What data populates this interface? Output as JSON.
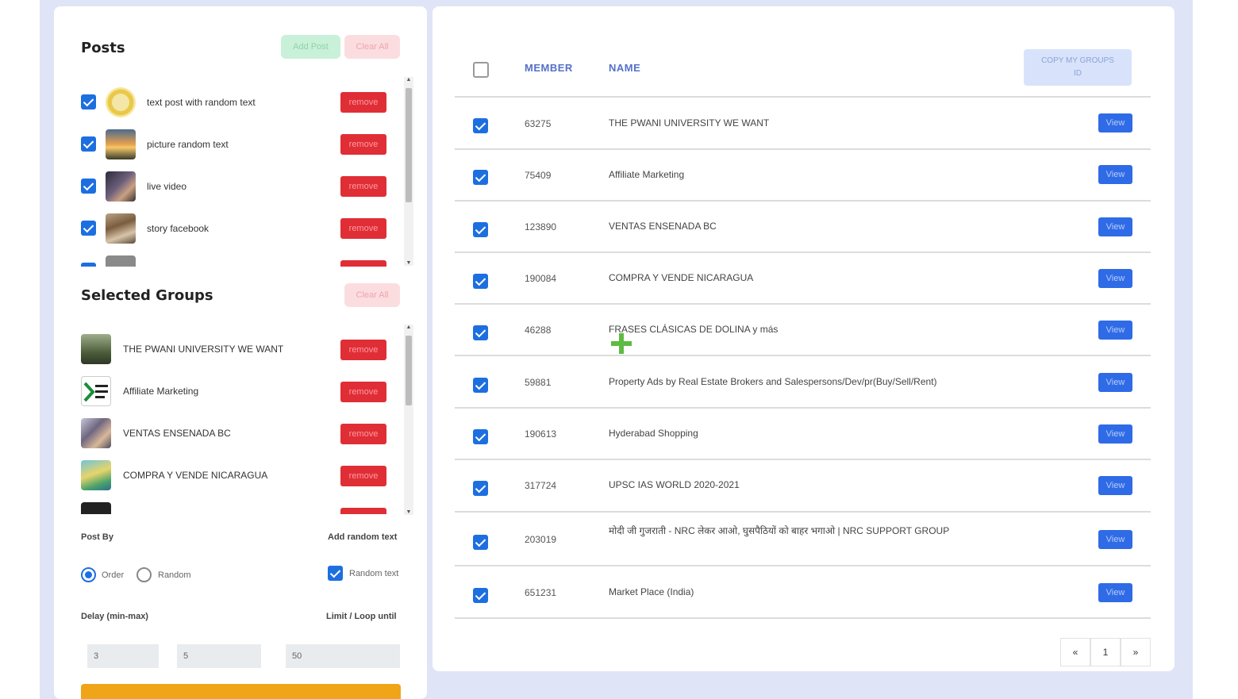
{
  "posts": {
    "title": "Posts",
    "add_post_label": "Add Post",
    "clear_all_label": "Clear All",
    "items": [
      {
        "label": "text post with random text",
        "checked": true,
        "remove_label": "remove"
      },
      {
        "label": "picture random text",
        "checked": true,
        "remove_label": "remove"
      },
      {
        "label": "live video",
        "checked": true,
        "remove_label": "remove"
      },
      {
        "label": "story facebook",
        "checked": true,
        "remove_label": "remove"
      }
    ]
  },
  "selected_groups": {
    "title": "Selected Groups",
    "clear_all_label": "Clear All",
    "items": [
      {
        "label": "THE PWANI UNIVERSITY WE WANT",
        "remove_label": "remove"
      },
      {
        "label": "Affiliate Marketing",
        "remove_label": "remove"
      },
      {
        "label": "VENTAS ENSENADA BC",
        "remove_label": "remove"
      },
      {
        "label": "COMPRA Y VENDE NICARAGUA",
        "remove_label": "remove"
      }
    ]
  },
  "settings": {
    "post_by_label": "Post By",
    "add_random_text_label": "Add random text",
    "option_order": "Order",
    "option_random": "Random",
    "selected_option": "Order",
    "random_text_label": "Random text",
    "random_text_checked": true,
    "delay_label": "Delay (min-max)",
    "limit_label": "Limit / Loop until",
    "delay_min": "3",
    "delay_max": "5",
    "limit_value": "50"
  },
  "table": {
    "col_member": "MEMBER",
    "col_name": "NAME",
    "copy_button_label": "COPY MY GROUPS ID",
    "view_label": "View",
    "rows": [
      {
        "member": "63275",
        "name": "THE PWANI UNIVERSITY WE WANT"
      },
      {
        "member": "75409",
        "name": "Affiliate Marketing"
      },
      {
        "member": "123890",
        "name": "VENTAS ENSENADA BC"
      },
      {
        "member": "190084",
        "name": "COMPRA Y VENDE NICARAGUA"
      },
      {
        "member": "46288",
        "name": "FRASES CLÁSICAS DE DOLINA y más"
      },
      {
        "member": "59881",
        "name": "Property Ads by Real Estate Brokers and Salespersons/Dev/pr(Buy/Sell/Rent)"
      },
      {
        "member": "190613",
        "name": "Hyderabad Shopping"
      },
      {
        "member": "317724",
        "name": "UPSC IAS WORLD 2020-2021"
      },
      {
        "member": "203019",
        "name": "मोदी जी गुजराती - NRC लेकर आओ, घुसपैठियों को बाहर भगाओ | NRC SUPPORT GROUP"
      },
      {
        "member": "651231",
        "name": "Market Place (India)"
      }
    ]
  },
  "pagination": {
    "prev": "«",
    "page": "1",
    "next": "»"
  },
  "colors": {
    "primary": "#1d6fe0",
    "danger": "#e02e36",
    "accent": "#f0a518"
  }
}
